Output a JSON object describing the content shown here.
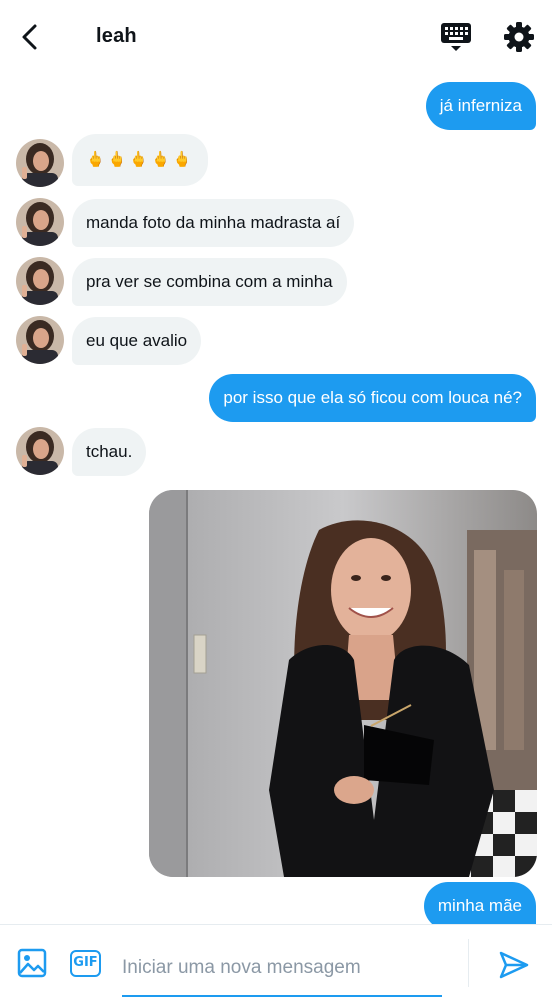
{
  "header": {
    "contact_name": "leah",
    "back_icon": "back-arrow-icon",
    "keyboard_icon": "keyboard-icon",
    "settings_icon": "gear-icon"
  },
  "messages": [
    {
      "direction": "out",
      "text": "já inferniza"
    },
    {
      "direction": "in",
      "text": "🖕🖕🖕🖕🖕"
    },
    {
      "direction": "in",
      "text": "manda foto da minha madrasta aí"
    },
    {
      "direction": "in",
      "text": "pra ver se combina com a minha"
    },
    {
      "direction": "in",
      "text": "eu que avalio"
    },
    {
      "direction": "out",
      "text": "por isso que ela só ficou com louca né?"
    },
    {
      "direction": "in",
      "text": "tchau."
    },
    {
      "direction": "out",
      "type": "image"
    },
    {
      "direction": "out",
      "text": "minha mãe"
    }
  ],
  "composer": {
    "placeholder": "Iniciar uma nova mensagem",
    "gif_label": "GIF",
    "image_icon": "image-icon",
    "send_icon": "send-icon"
  },
  "colors": {
    "accent": "#1d9bf0",
    "incoming_bubble": "#eff3f4",
    "text": "#0f1419"
  }
}
